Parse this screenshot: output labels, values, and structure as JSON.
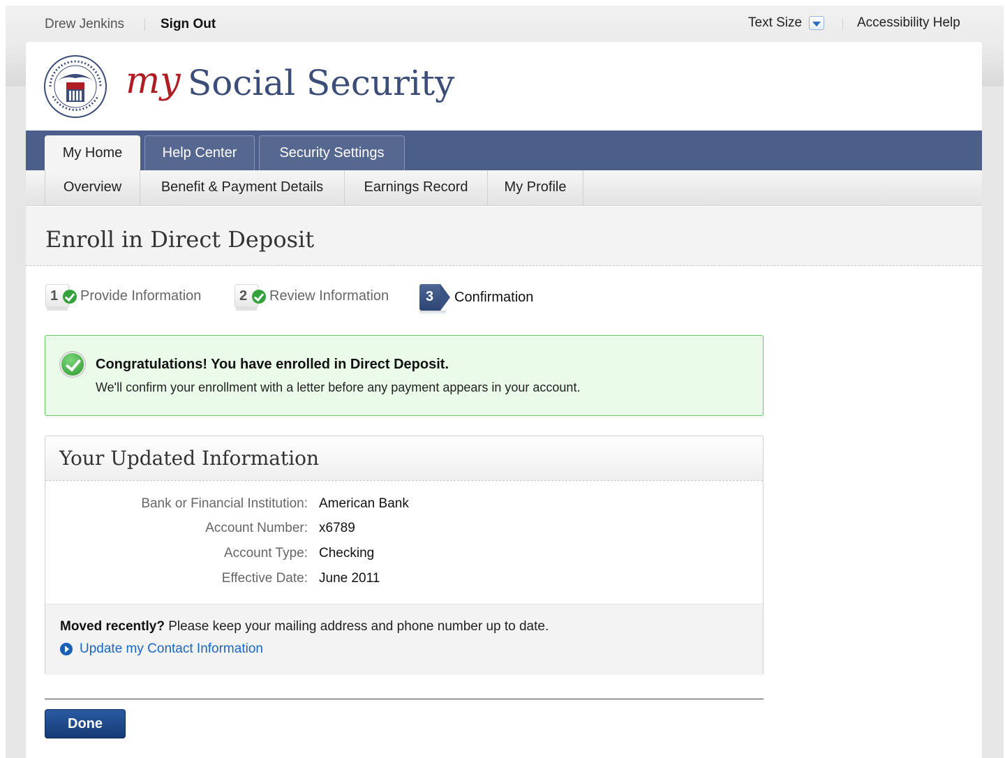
{
  "utility": {
    "user_name": "Drew Jenkins",
    "sign_out": "Sign Out",
    "text_size": "Text Size",
    "accessibility_help": "Accessibility Help"
  },
  "brand": {
    "my": "my",
    "name": "Social Security"
  },
  "tabs": [
    {
      "label": "My Home",
      "active": true
    },
    {
      "label": "Help Center",
      "active": false
    },
    {
      "label": "Security Settings",
      "active": false
    }
  ],
  "subnav": [
    {
      "label": "Overview"
    },
    {
      "label": "Benefit & Payment Details"
    },
    {
      "label": "Earnings Record"
    },
    {
      "label": "My Profile"
    }
  ],
  "page_title": "Enroll in Direct Deposit",
  "steps": [
    {
      "number": "1",
      "label": "Provide Information",
      "status": "complete"
    },
    {
      "number": "2",
      "label": "Review Information",
      "status": "complete"
    },
    {
      "number": "3",
      "label": "Confirmation",
      "status": "current"
    }
  ],
  "success": {
    "title": "Congratulations! You have enrolled in Direct Deposit.",
    "body": "We'll confirm your enrollment with a letter before any payment appears in your account."
  },
  "updated_info": {
    "heading": "Your Updated Information",
    "rows": [
      {
        "label": "Bank or Financial Institution:",
        "value": "American Bank"
      },
      {
        "label": "Account Number:",
        "value": "x6789"
      },
      {
        "label": "Account Type:",
        "value": "Checking"
      },
      {
        "label": "Effective Date:",
        "value": "June 2011"
      }
    ],
    "moved_bold": "Moved recently?",
    "moved_text": "Please keep your mailing address and phone number up to date.",
    "update_link": "Update my Contact Information"
  },
  "done_button": "Done",
  "colors": {
    "nav_blue": "#4c5f8a",
    "brand_red": "#b01c24",
    "brand_blue": "#3c4d78",
    "success_green": "#34a23c",
    "link_blue": "#1a66c2"
  }
}
